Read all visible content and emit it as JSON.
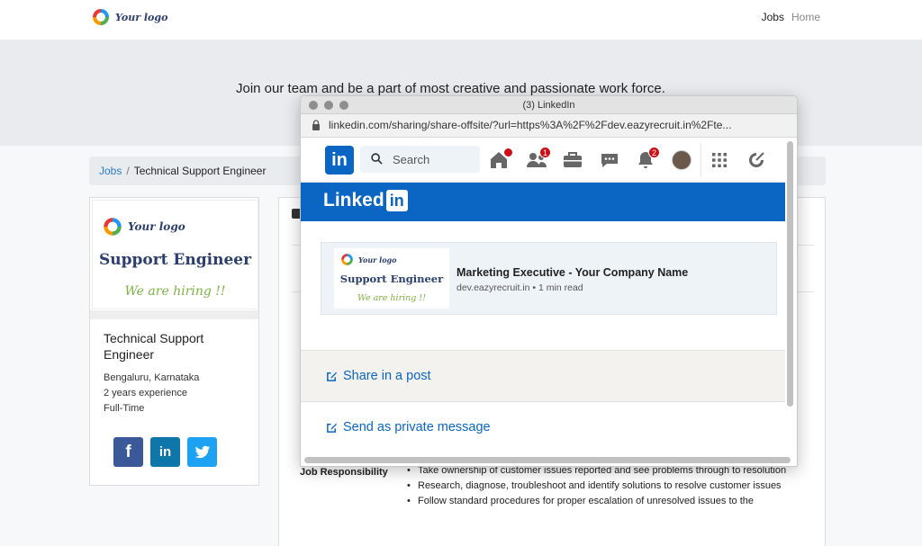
{
  "header": {
    "logo_text": "Your logo",
    "nav": {
      "jobs": "Jobs",
      "home": "Home"
    }
  },
  "hero": {
    "text": "Join our team and be a part of most creative and passionate work force."
  },
  "breadcrumb": {
    "jobs": "Jobs",
    "separator": "/",
    "current": "Technical Support Engineer"
  },
  "job_card": {
    "logo_text": "Your logo",
    "banner_title": "Support Engineer",
    "banner_hiring": "We are hiring !!",
    "title": "Technical Support Engineer",
    "location": "Bengaluru, Karnataka",
    "experience": "2 years experience",
    "type": "Full-Time",
    "social": {
      "facebook": "f",
      "linkedin": "in"
    }
  },
  "details": {
    "jr_label": "Job Responsibility",
    "bullets": [
      "Take ownership of customer issues reported and see problems through to resolution",
      "Research, diagnose, troubleshoot and identify solutions to resolve customer issues",
      "Follow standard procedures for proper escalation of unresolved issues to the"
    ]
  },
  "popup": {
    "window_title": "(3) LinkedIn",
    "url": "linkedin.com/sharing/share-offsite/?url=https%3A%2F%2Fdev.eazyrecruit.in%2Fte...",
    "nav": {
      "logo": "in",
      "search_placeholder": "Search",
      "badges": {
        "messaging_badge": "1",
        "notifications_badge": "2"
      }
    },
    "banner_wordmark": "Linked",
    "banner_in": "in",
    "preview": {
      "logo_text": "Your logo",
      "thumb_title": "Support Engineer",
      "thumb_hiring": "We are hiring !!",
      "title": "Marketing Executive - Your Company Name",
      "subtitle": "dev.eazyrecruit.in • 1 min read"
    },
    "share_in_post": "Share in a post",
    "send_private": "Send as private message"
  },
  "colors": {
    "linkedin_blue": "#0a66c2",
    "facebook_blue": "#3b5998",
    "linkedin_button": "#0e76a8",
    "twitter_blue": "#1da1f2",
    "link_blue": "#2a7bd3",
    "badge_red": "#cc1016"
  }
}
